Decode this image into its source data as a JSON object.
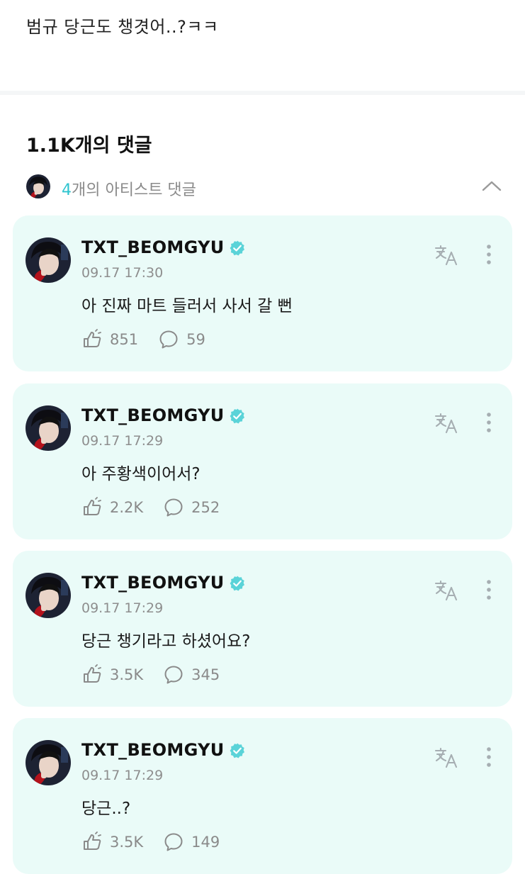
{
  "post": {
    "text": "범규 당근도 챙겻어..?ㅋㅋ"
  },
  "comments_header": {
    "title": "1.1K개의 댓글"
  },
  "artist_section": {
    "count": "4",
    "label": "개의 아티스트 댓글"
  },
  "colors": {
    "accent": "#2ec4cf",
    "card_bg": "#eafbf8",
    "verified": "#5ad3d8"
  },
  "comments": [
    {
      "author": "TXT_BEOMGYU",
      "time": "09.17 17:30",
      "text": "아 진짜 마트 들러서 사서 갈 뻔",
      "likes": "851",
      "replies": "59"
    },
    {
      "author": "TXT_BEOMGYU",
      "time": "09.17 17:29",
      "text": "아 주황색이어서?",
      "likes": "2.2K",
      "replies": "252"
    },
    {
      "author": "TXT_BEOMGYU",
      "time": "09.17 17:29",
      "text": "당근 챙기라고 하셨어요?",
      "likes": "3.5K",
      "replies": "345"
    },
    {
      "author": "TXT_BEOMGYU",
      "time": "09.17 17:29",
      "text": "당근..?",
      "likes": "3.5K",
      "replies": "149"
    }
  ],
  "icons": {
    "verified": "verified-badge-icon",
    "translate": "translate-icon",
    "more": "more-vertical-icon",
    "like": "like-hand-icon",
    "reply": "speech-bubble-icon",
    "collapse": "chevron-up-icon"
  }
}
